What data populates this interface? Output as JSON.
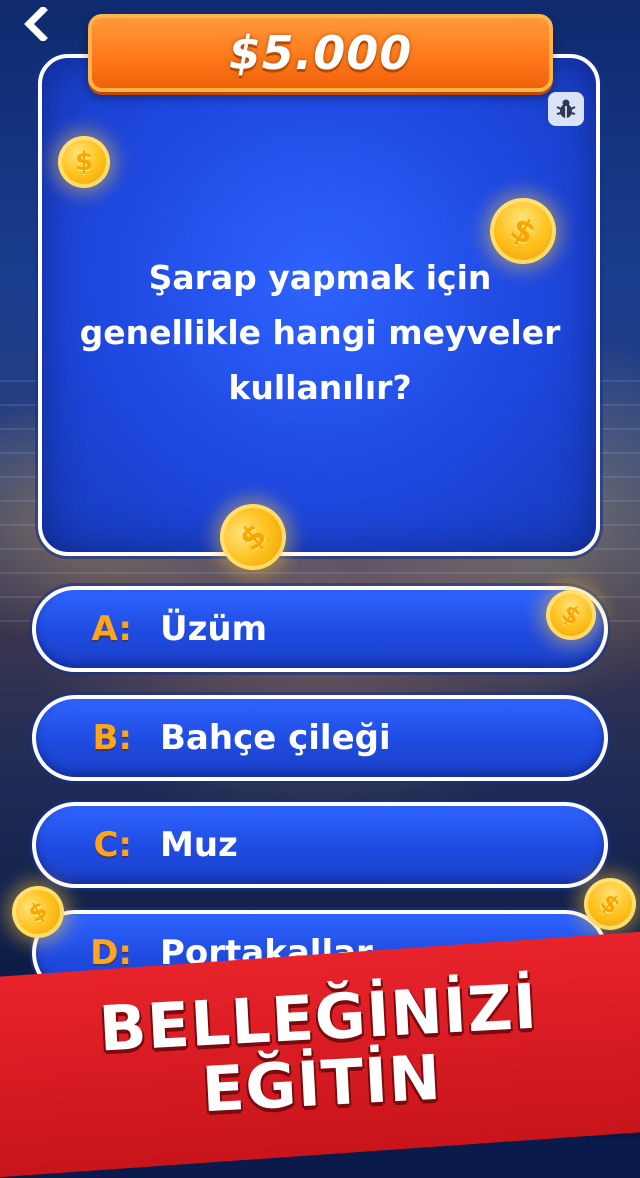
{
  "header": {
    "prize": "$5.000"
  },
  "question": {
    "text": "Şarap yapmak için genellikle hangi meyveler kullanılır?"
  },
  "answers": [
    {
      "letter": "A:",
      "text": "Üzüm"
    },
    {
      "letter": "B:",
      "text": "Bahçe çileği"
    },
    {
      "letter": "C:",
      "text": "Muz"
    },
    {
      "letter": "D:",
      "text": "Portakallar"
    }
  ],
  "promo": {
    "line1": "BELLEĞİNİZİ",
    "line2": "EĞİTİN"
  },
  "icons": {
    "back": "chevron-left-icon",
    "bug": "bug-icon",
    "coin": "dollar-coin-icon"
  },
  "colors": {
    "prize_banner": "#ff7a1c",
    "card_blue": "#1e48e0",
    "answer_letter": "#ffa51c",
    "promo_red": "#e8232a"
  }
}
